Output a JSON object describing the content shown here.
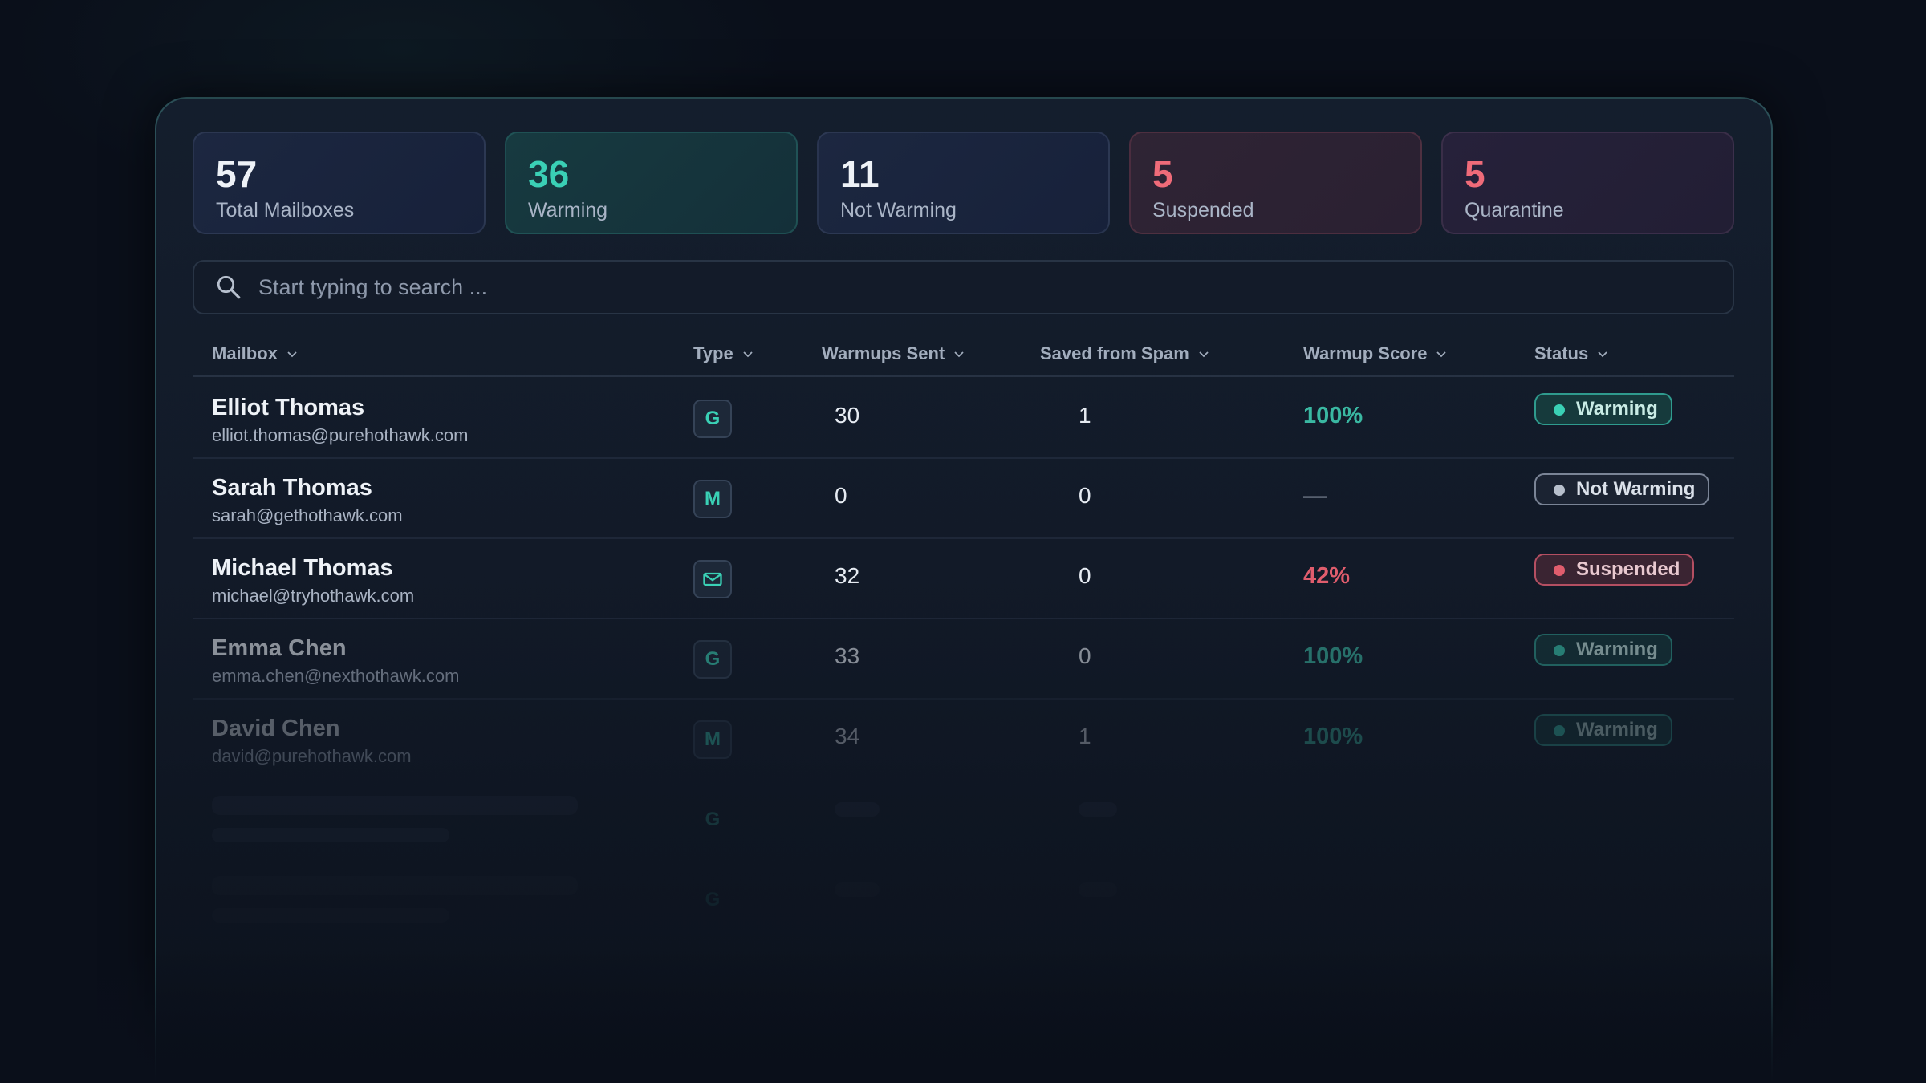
{
  "stats": [
    {
      "value": "57",
      "label": "Total Mailboxes",
      "variant": "default"
    },
    {
      "value": "36",
      "label": "Warming",
      "variant": "teal"
    },
    {
      "value": "11",
      "label": "Not Warming",
      "variant": "default"
    },
    {
      "value": "5",
      "label": "Suspended",
      "variant": "red"
    },
    {
      "value": "5",
      "label": "Quarantine",
      "variant": "plum"
    }
  ],
  "search": {
    "placeholder": "Start typing to search ...",
    "icon": "search-icon"
  },
  "table": {
    "columns": [
      "Mailbox",
      "Type",
      "Warmups Sent",
      "Saved from Spam",
      "Warmup Score",
      "Status"
    ],
    "rows": [
      {
        "name": "Elliot Thomas",
        "email": "elliot.thomas@purehothawk.com",
        "type": "G",
        "type_icon": "google-icon",
        "sent": "30",
        "saved": "1",
        "score": "100%",
        "score_kind": "good",
        "status": "Warming",
        "status_kind": "warming"
      },
      {
        "name": "Sarah Thomas",
        "email": "sarah@gethothawk.com",
        "type": "M",
        "type_icon": "microsoft-icon",
        "sent": "0",
        "saved": "0",
        "score": "—",
        "score_kind": "none",
        "status": "Not Warming",
        "status_kind": "notwarming"
      },
      {
        "name": "Michael Thomas",
        "email": "michael@tryhothawk.com",
        "type": "",
        "type_icon": "mail-icon",
        "sent": "32",
        "saved": "0",
        "score": "42%",
        "score_kind": "bad",
        "status": "Suspended",
        "status_kind": "suspended"
      },
      {
        "name": "Emma Chen",
        "email": "emma.chen@nexthothawk.com",
        "type": "G",
        "type_icon": "google-icon",
        "sent": "33",
        "saved": "0",
        "score": "100%",
        "score_kind": "good",
        "status": "Warming",
        "status_kind": "warming"
      },
      {
        "name": "David Chen",
        "email": "david@purehothawk.com",
        "type": "M",
        "type_icon": "microsoft-icon",
        "sent": "34",
        "saved": "1",
        "score": "100%",
        "score_kind": "good",
        "status": "Warming",
        "status_kind": "warming"
      }
    ],
    "skeleton_rows": [
      {
        "type": "G"
      },
      {
        "type": "G"
      }
    ]
  },
  "colors": {
    "accent_teal": "#3ad0b5",
    "danger_red": "#e05d6d",
    "background": "#0a0f1a"
  }
}
